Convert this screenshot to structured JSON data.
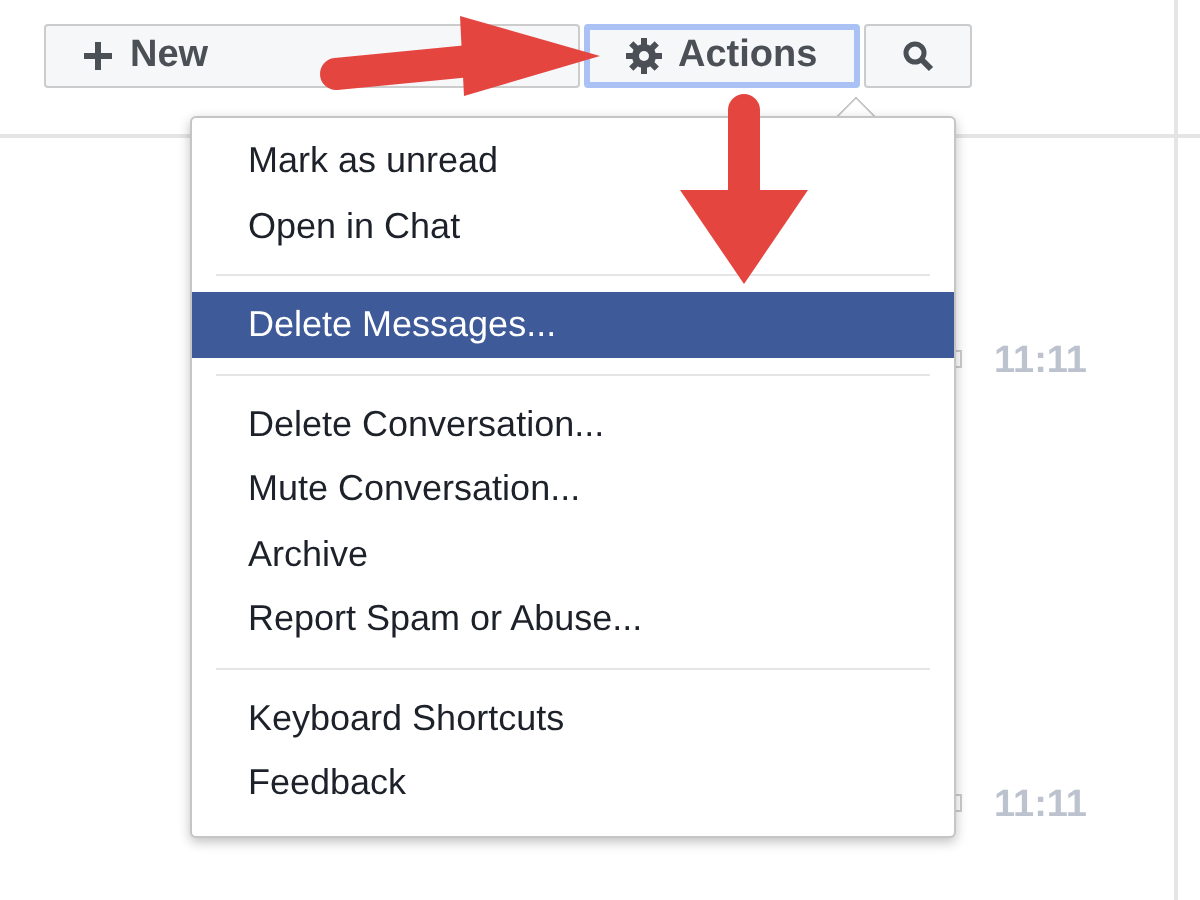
{
  "toolbar": [
    {
      "kind": "new",
      "label": "New",
      "focused": false
    },
    {
      "kind": "actions",
      "label": "Actions",
      "focused": true
    },
    {
      "kind": "search",
      "focused": false
    }
  ],
  "menu": {
    "groups": [
      [
        {
          "label": "Mark as unread",
          "selected": false
        },
        {
          "label": "Open in Chat",
          "selected": false
        }
      ],
      [
        {
          "label": "Delete Messages...",
          "selected": true
        }
      ],
      [
        {
          "label": "Delete Conversation...",
          "selected": false
        },
        {
          "label": "Mute Conversation...",
          "selected": false
        },
        {
          "label": "Archive",
          "selected": false
        },
        {
          "label": "Report Spam or Abuse...",
          "selected": false
        }
      ],
      [
        {
          "label": "Keyboard Shortcuts",
          "selected": false
        },
        {
          "label": "Feedback",
          "selected": false
        }
      ]
    ]
  },
  "thread_times": [
    "11:11",
    "11:11"
  ]
}
